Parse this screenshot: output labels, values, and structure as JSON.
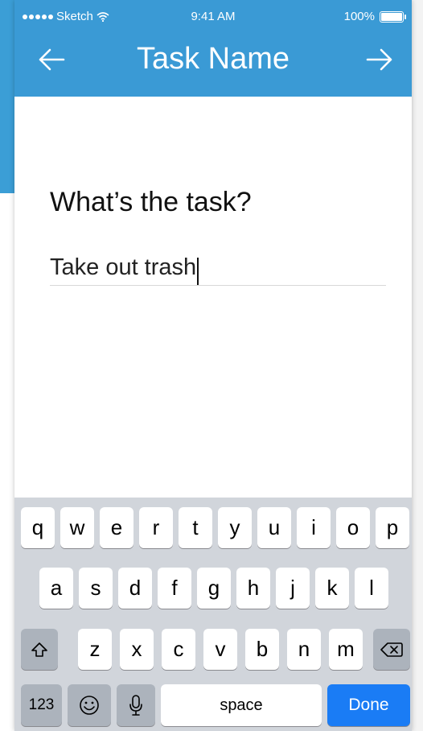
{
  "status_bar": {
    "carrier": "Sketch",
    "time": "9:41 AM",
    "battery": "100%"
  },
  "nav": {
    "title": "Task Name",
    "back_icon": "arrow-left-icon",
    "forward_icon": "arrow-right-icon"
  },
  "form": {
    "question": "What’s the task?",
    "value": "Take out trash"
  },
  "keyboard": {
    "row1": [
      "q",
      "w",
      "e",
      "r",
      "t",
      "y",
      "u",
      "i",
      "o",
      "p"
    ],
    "row2": [
      "a",
      "s",
      "d",
      "f",
      "g",
      "h",
      "j",
      "k",
      "l"
    ],
    "row3": [
      "z",
      "x",
      "c",
      "v",
      "b",
      "n",
      "m"
    ],
    "numbers_label": "123",
    "space_label": "space",
    "done_label": "Done"
  },
  "colors": {
    "header": "#3a9ad5",
    "done_key": "#1a7cf5"
  }
}
